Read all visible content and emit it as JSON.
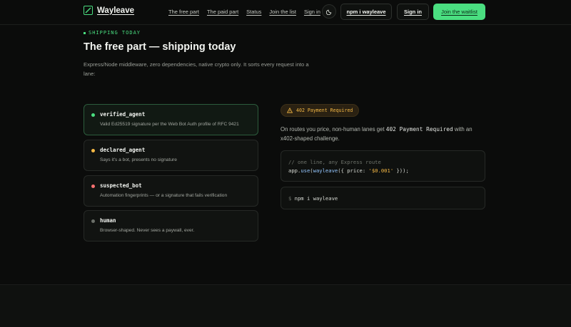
{
  "brand": {
    "name": "Wayleave"
  },
  "nav": {
    "items": [
      "The free part",
      "The paid part",
      "Status",
      "Join the list",
      "Sign in"
    ]
  },
  "header_buttons": {
    "npm": "npm i wayleave",
    "signin": "Sign in",
    "waitlist": "Join the waitlist"
  },
  "hero": {
    "eyebrow": "SHIPPING TODAY",
    "title": "The free part — shipping today",
    "lede": "Express/Node middleware, zero dependencies, native crypto only. It sorts every request into a lane:"
  },
  "lanes": [
    {
      "name": "verified_agent",
      "desc": "Valid Ed25519 signature per the Web Bot Auth profile of RFC 9421",
      "color": "#4ade80"
    },
    {
      "name": "declared_agent",
      "desc": "Says it's a bot, presents no signature",
      "color": "#f5b945"
    },
    {
      "name": "suspected_bot",
      "desc": "Automation fingerprints — or a signature that fails verification",
      "color": "#f87171"
    },
    {
      "name": "human",
      "desc": "Browser-shaped. Never sees a paywall, ever.",
      "color": "#6b6f69"
    }
  ],
  "payment": {
    "badge": "402 Payment Required",
    "text_before": "On routes you price, non-human lanes get ",
    "code": "402 Payment Required",
    "text_after": " with an x402-shaped challenge."
  },
  "code_sample": {
    "comment": "// one line, any Express route",
    "obj": "app",
    "dot": ".",
    "use": "use",
    "open": "(",
    "fn": "wayleave",
    "args_open": "({ price: ",
    "price": "'$0.001'",
    "args_close": " }));"
  },
  "install": {
    "prompt": "$",
    "command": "npm i wayleave"
  },
  "colors": {
    "accent": "#4ade80",
    "warning": "#f5b945",
    "danger": "#f87171",
    "background": "#0b0c0b"
  }
}
